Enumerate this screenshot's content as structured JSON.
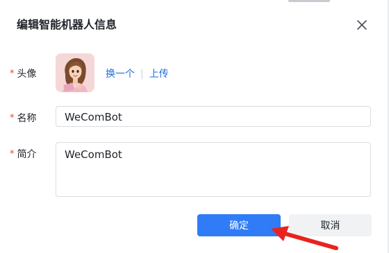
{
  "dialog": {
    "title": "编辑智能机器人信息"
  },
  "form": {
    "avatar": {
      "label": "头像",
      "change_link": "换一个",
      "upload_link": "上传"
    },
    "name": {
      "label": "名称",
      "value": "WeComBot"
    },
    "intro": {
      "label": "简介",
      "value": "WeComBot"
    },
    "required_mark": "*"
  },
  "footer": {
    "confirm_label": "确定",
    "cancel_label": "取消"
  },
  "icons": {
    "close": "close-icon",
    "annotation": "red-arrow-annotation"
  },
  "colors": {
    "primary": "#2f7cf6",
    "link": "#1c6edb",
    "required": "#e54545",
    "annotation": "#e8231f"
  }
}
